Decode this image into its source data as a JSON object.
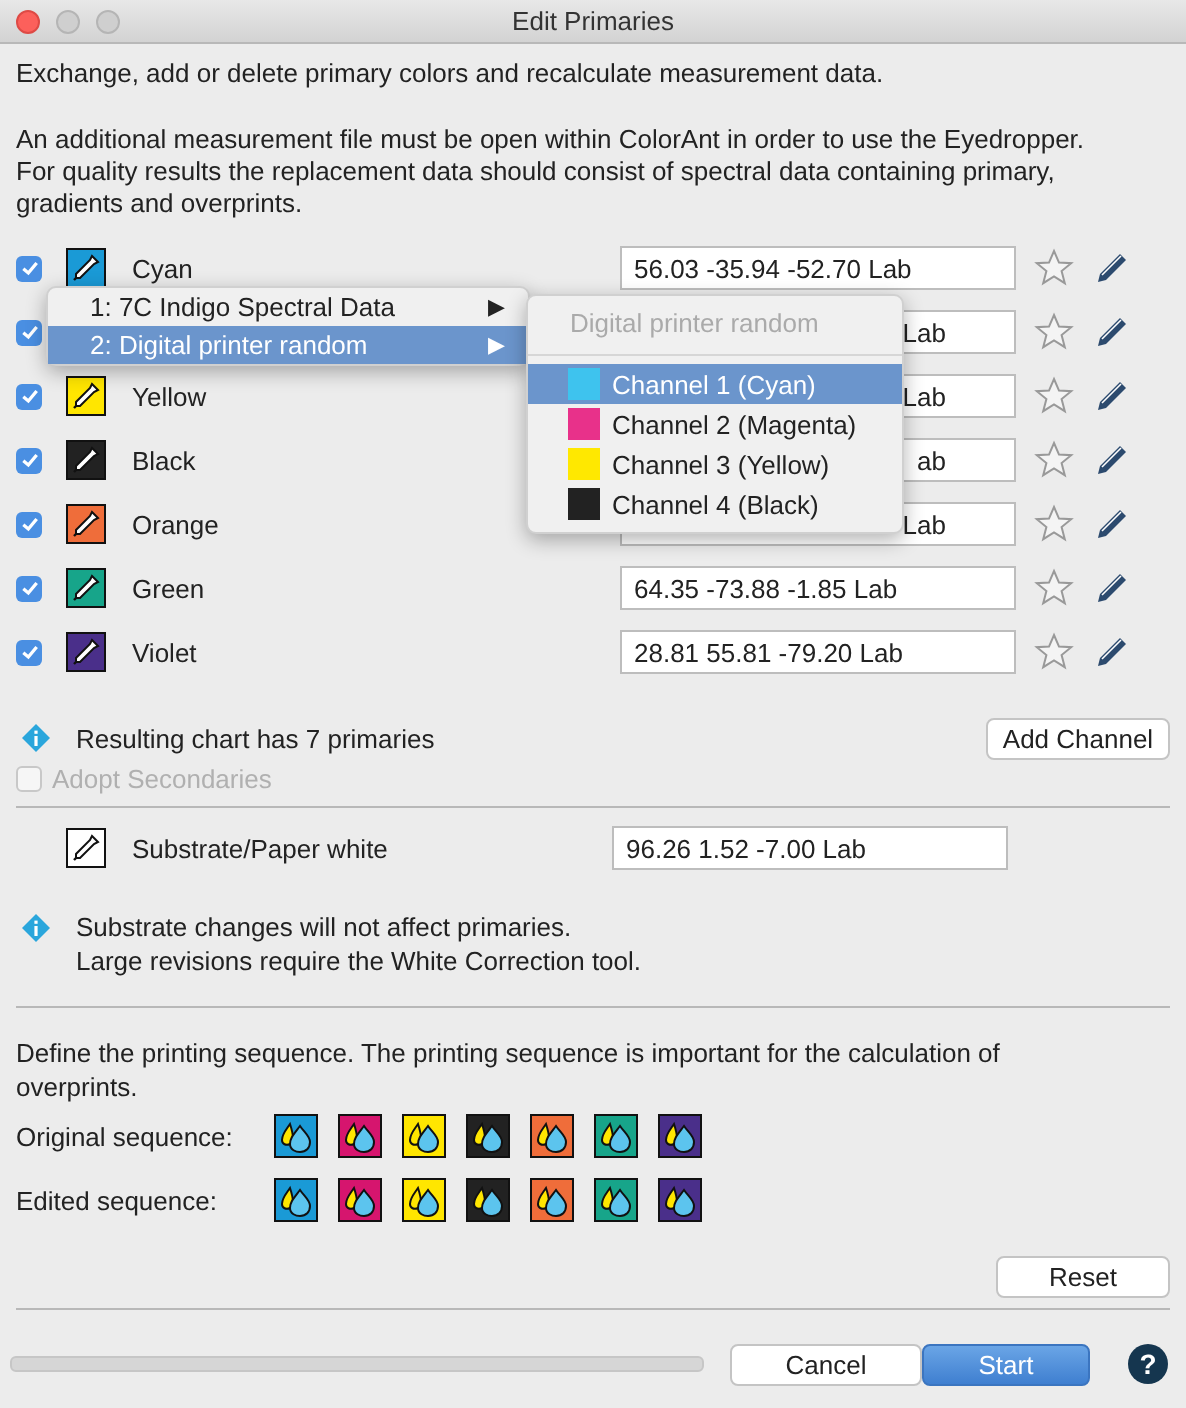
{
  "window": {
    "title": "Edit Primaries"
  },
  "intro": "Exchange, add or delete primary colors and recalculate measurement data.",
  "notes": [
    "An additional measurement file must be open within ColorAnt in order to use the Eyedropper.",
    "For quality results the replacement data should consist of spectral data containing primary, gradients and overprints."
  ],
  "primaries": [
    {
      "name": "Cyan",
      "color": "#1a9ad6",
      "checked": true,
      "value": "56.03 -35.94 -52.70 Lab",
      "covered": false
    },
    {
      "checked": true,
      "value": "Lab",
      "covered": true
    },
    {
      "name": "Yellow",
      "color": "#ffe600",
      "checked": true,
      "value": "Lab",
      "covered": true
    },
    {
      "name": "Black",
      "color": "#222222",
      "checked": true,
      "value": "ab",
      "covered": true
    },
    {
      "name": "Orange",
      "color": "#ef6d3a",
      "checked": true,
      "value": "Lab",
      "covered": true
    },
    {
      "name": "Green",
      "color": "#17a58a",
      "checked": true,
      "value": "64.35 -73.88 -1.85 Lab",
      "covered": false
    },
    {
      "name": "Violet",
      "color": "#4a2f8a",
      "checked": true,
      "value": "28.81 55.81 -79.20 Lab",
      "covered": false
    }
  ],
  "source_menu": {
    "items": [
      {
        "label": "1: 7C Indigo Spectral Data",
        "arrow": "▶",
        "selected": false
      },
      {
        "label": "2: Digital printer random",
        "arrow": "▶",
        "selected": true
      }
    ]
  },
  "channel_menu": {
    "header": "Digital printer random",
    "items": [
      {
        "label": "Channel 1 (Cyan)",
        "color": "#3ec3ee",
        "selected": true
      },
      {
        "label": "Channel 2 (Magenta)",
        "color": "#e8318a",
        "selected": false
      },
      {
        "label": "Channel 3 (Yellow)",
        "color": "#ffe800",
        "selected": false
      },
      {
        "label": "Channel 4 (Black)",
        "color": "#222222",
        "selected": false
      }
    ]
  },
  "result_info": "Resulting chart has 7 primaries",
  "add_button": "Add Channel",
  "adopt_secondaries": {
    "label": "Adopt Secondaries",
    "checked": false,
    "disabled": true
  },
  "substrate": {
    "label": "Substrate/Paper white",
    "value": "96.26 1.52 -7.00 Lab"
  },
  "substrate_info": [
    "Substrate changes will not affect primaries.",
    "Large revisions require the White Correction tool."
  ],
  "sequence_text": "Define the printing sequence. The printing sequence is important for the calculation of overprints.",
  "sequences": [
    {
      "label": "Original sequence:",
      "items": [
        {
          "color": "#1a9ad6"
        },
        {
          "color": "#d6156e"
        },
        {
          "color": "#ffe600"
        },
        {
          "color": "#222222"
        },
        {
          "color": "#ef6d3a"
        },
        {
          "color": "#17a58a"
        },
        {
          "color": "#4a2f8a"
        }
      ]
    },
    {
      "label": "Edited sequence:",
      "items": [
        {
          "color": "#1a9ad6"
        },
        {
          "color": "#d6156e"
        },
        {
          "color": "#ffe600"
        },
        {
          "color": "#222222"
        },
        {
          "color": "#ef6d3a"
        },
        {
          "color": "#17a58a"
        },
        {
          "color": "#4a2f8a"
        }
      ]
    }
  ],
  "reset_button": "Reset",
  "cancel_button": "Cancel",
  "start_button": "Start",
  "help_button": "?",
  "progress": {
    "level": 0
  }
}
